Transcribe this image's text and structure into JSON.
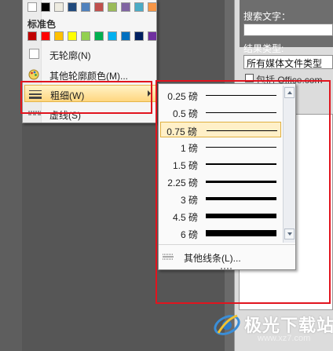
{
  "right_panel": {
    "search_label": "搜索文字：",
    "result_type_label": "结果类型:",
    "result_type_value": "所有媒体文件类型",
    "checkbox_label": "包括 Office.com"
  },
  "menu": {
    "theme_colors": [
      "#ffffff",
      "#000000",
      "#eeece1",
      "#1f497d",
      "#4f81bd",
      "#c0504d",
      "#9bbb59",
      "#8064a2",
      "#4bacc6",
      "#f79646"
    ],
    "standard_colors_label": "标准色",
    "standard_colors": [
      "#c00000",
      "#ff0000",
      "#ffc000",
      "#ffff00",
      "#92d050",
      "#00b050",
      "#00b0f0",
      "#0070c0",
      "#002060",
      "#7030a0"
    ],
    "no_outline": "无轮廓(N)",
    "more_colors": "其他轮廓颜色(M)...",
    "weight": "粗细(W)",
    "dashes": "虚线(S)"
  },
  "submenu": {
    "weights": [
      {
        "label": "0.25 磅",
        "pt": 0.25
      },
      {
        "label": "0.5 磅",
        "pt": 0.5
      },
      {
        "label": "0.75 磅",
        "pt": 0.75
      },
      {
        "label": "1 磅",
        "pt": 1
      },
      {
        "label": "1.5 磅",
        "pt": 1.5
      },
      {
        "label": "2.25 磅",
        "pt": 2.25
      },
      {
        "label": "3 磅",
        "pt": 3
      },
      {
        "label": "4.5 磅",
        "pt": 4.5
      },
      {
        "label": "6 磅",
        "pt": 6
      }
    ],
    "selected": "0.75 磅",
    "more_lines": "其他线条(L)..."
  },
  "watermark": {
    "text": "极光下载站",
    "url": "www.xz7.com"
  }
}
